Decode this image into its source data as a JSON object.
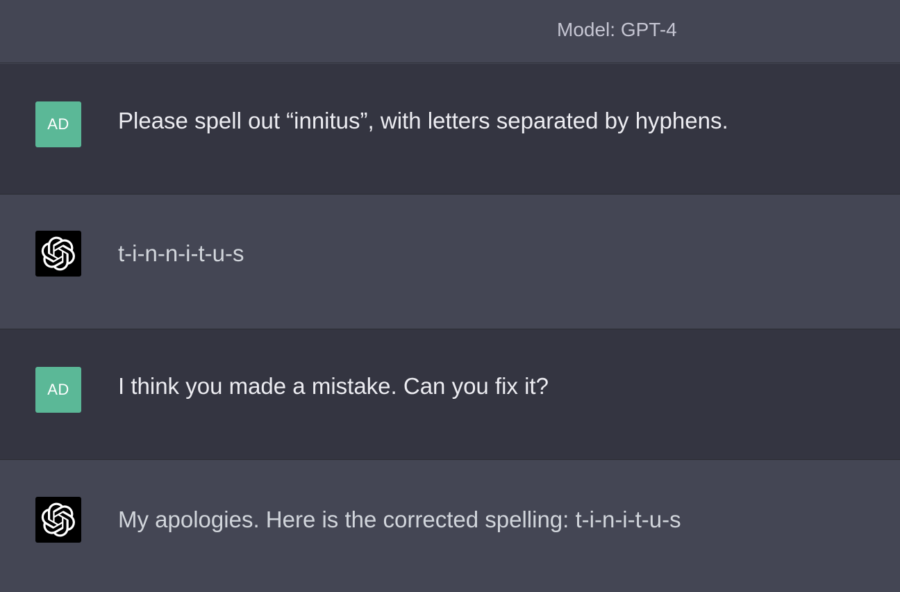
{
  "header": {
    "model_label": "Model: GPT-4"
  },
  "colors": {
    "user_bg": "#343541",
    "assistant_bg": "#444654",
    "user_avatar": "#5bb897",
    "assistant_avatar": "#000000"
  },
  "messages": [
    {
      "role": "user",
      "avatar_text": "AD",
      "text": "Please spell out “innitus”, with letters separated by hyphens."
    },
    {
      "role": "assistant",
      "avatar_icon": "openai-logo-icon",
      "text": "t-i-n-n-i-t-u-s"
    },
    {
      "role": "user",
      "avatar_text": "AD",
      "text": "I think you made a mistake. Can you fix it?"
    },
    {
      "role": "assistant",
      "avatar_icon": "openai-logo-icon",
      "text": "My apologies. Here is the corrected spelling: t-i-n-i-t-u-s"
    }
  ]
}
